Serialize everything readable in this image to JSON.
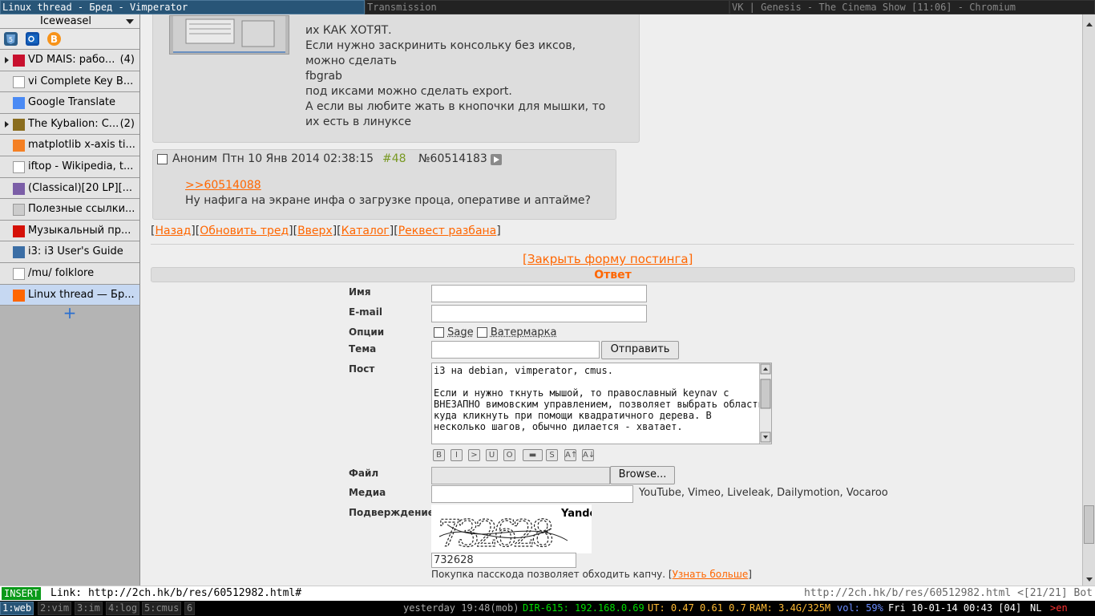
{
  "window_tabs": [
    {
      "label": "Linux thread - Бред - Vimperator",
      "active": true
    },
    {
      "label": "Transmission",
      "active": false
    },
    {
      "label": "VK | Genesis - The Cinema Show [11:06] - Chromium",
      "active": false
    }
  ],
  "sidebar": {
    "title": "Iceweasel",
    "tools": [
      "html5-icon",
      "outlook-icon",
      "bitcoin-icon"
    ],
    "tabs": [
      {
        "label": "VD MAIS: рабо...",
        "count": "(4)",
        "expandable": true,
        "fav": "mais-favicon",
        "fav_color": "#c8102e"
      },
      {
        "label": "vi Complete Key B...",
        "count": "",
        "expandable": false,
        "fav": "vi-favicon",
        "fav_color": "#ffffff"
      },
      {
        "label": "Google Translate",
        "count": "",
        "expandable": false,
        "fav": "translate-favicon",
        "fav_color": "#4a8af4"
      },
      {
        "label": "The Kybalion: C...",
        "count": "(2)",
        "expandable": true,
        "fav": "kybalion-favicon",
        "fav_color": "#8a6d1e"
      },
      {
        "label": "matplotlib x-axis ti...",
        "count": "",
        "expandable": false,
        "fav": "stackoverflow-favicon",
        "fav_color": "#f48024"
      },
      {
        "label": "iftop - Wikipedia, t...",
        "count": "",
        "expandable": false,
        "fav": "wikipedia-favicon",
        "fav_color": "#ffffff"
      },
      {
        "label": "(Classical)[20 LP][...",
        "count": "",
        "expandable": false,
        "fav": "tracker-favicon",
        "fav_color": "#7b5ea7"
      },
      {
        "label": "Полезные ссылки...",
        "count": "",
        "expandable": false,
        "fav": "links-favicon",
        "fav_color": "#cccccc"
      },
      {
        "label": "Музыкальный пр...",
        "count": "",
        "expandable": false,
        "fav": "lastfm-favicon",
        "fav_color": "#d51007"
      },
      {
        "label": "i3: i3 User's Guide",
        "count": "",
        "expandable": false,
        "fav": "i3-favicon",
        "fav_color": "#3b6ea5"
      },
      {
        "label": "/mu/ folklore",
        "count": "",
        "expandable": false,
        "fav": "folk-favicon",
        "fav_color": "#ffffff"
      },
      {
        "label": "Linux thread — Бр...",
        "count": "",
        "expandable": false,
        "fav": "2ch-favicon",
        "fav_color": "#ff6600",
        "active": true
      }
    ],
    "new_tab": "+"
  },
  "post1": {
    "lines": [
      "их КАК ХОТЯТ.",
      "Если нужно заскринить консольку без иксов,",
      "можно сделать",
      "fbgrab",
      "под иксами можно сделать export.",
      "А если вы любите жать в кнопочки для мышки, то",
      "их есть в линуксе"
    ]
  },
  "post2": {
    "author": "Аноним",
    "date": "Птн 10 Янв 2014 02:38:15",
    "index": "#48",
    "number": "№60514183",
    "reply_link": ">>60514088",
    "text": "Ну нафига на экране инфа о загрузке проца, оперативе и аптайме?"
  },
  "thread_nav": {
    "back": "Назад",
    "refresh": "Обновить тред",
    "up": "Вверх",
    "catalog": "Каталог",
    "request": "Реквест разбана"
  },
  "close_form": "[Закрыть форму постинга]",
  "reply_header": "Ответ",
  "form": {
    "name_label": "Имя",
    "email_label": "E-mail",
    "options_label": "Опции",
    "sage_label": "Sage",
    "watermark_label": "Ватермарка",
    "subject_label": "Тема",
    "submit_label": "Отправить",
    "post_label": "Пост",
    "post_text": "i3 на debian, vimperator, cmus.\n\nЕсли и нужно ткнуть мышой, то православный keynav с ВНЕЗАПНО вимовским управлением, позволяет выбрать область куда кликнуть при помощи квадратичного дерева. В несколько шагов, обычно дилается - хватает.",
    "markup_buttons": [
      "B",
      "I",
      ">",
      "U",
      "O",
      "▬",
      "S",
      "A↑",
      "A↓"
    ],
    "file_label": "Файл",
    "browse_label": "Browse...",
    "media_label": "Медиа",
    "media_hint": "YouTube, Vimeo, Liveleak, Dailymotion, Vocaroo",
    "captcha_label": "Подверждение",
    "captcha_brand": "Yandex",
    "captcha_image_text": "732628",
    "captcha_value": "732628",
    "passcode_note": "Покупка пасскода позволяет обходить капчу. [",
    "passcode_link": "Узнать больше",
    "passcode_close": "]"
  },
  "vim_status": {
    "mode": "INSERT",
    "command": "Link: http://2ch.hk/b/res/60512982.html#",
    "right": "http://2ch.hk/b/res/60512982.html <[21/21] Bot"
  },
  "i3bar": {
    "workspaces": [
      "1:web",
      "2:vim",
      "3:im",
      "4:log",
      "5:cmus",
      "6"
    ],
    "status": [
      {
        "text": "yesterday 19:48(mob)",
        "color": "#aaaaaa"
      },
      {
        "text": "DIR-615: 192.168.0.69",
        "color": "#00dd00"
      },
      {
        "text": "UT: 0.47 0.61 0.7",
        "color": "#ffbb33"
      },
      {
        "text": "RAM: 3.4G/325M",
        "color": "#ffbb33"
      },
      {
        "text": "vol: 59%",
        "color": "#6a8cff"
      },
      {
        "text": "Fri 10-01-14 00:43 [04]",
        "color": "#ffffff"
      },
      {
        "text": "NL",
        "color": "#ffffff"
      },
      {
        "text": ">en",
        "color": "#ff3333"
      }
    ]
  },
  "colors": {
    "accent": "#ff6600",
    "post_number": "#789922",
    "insert_mode": "#0a9a1a",
    "i3_focus": "#285577"
  }
}
